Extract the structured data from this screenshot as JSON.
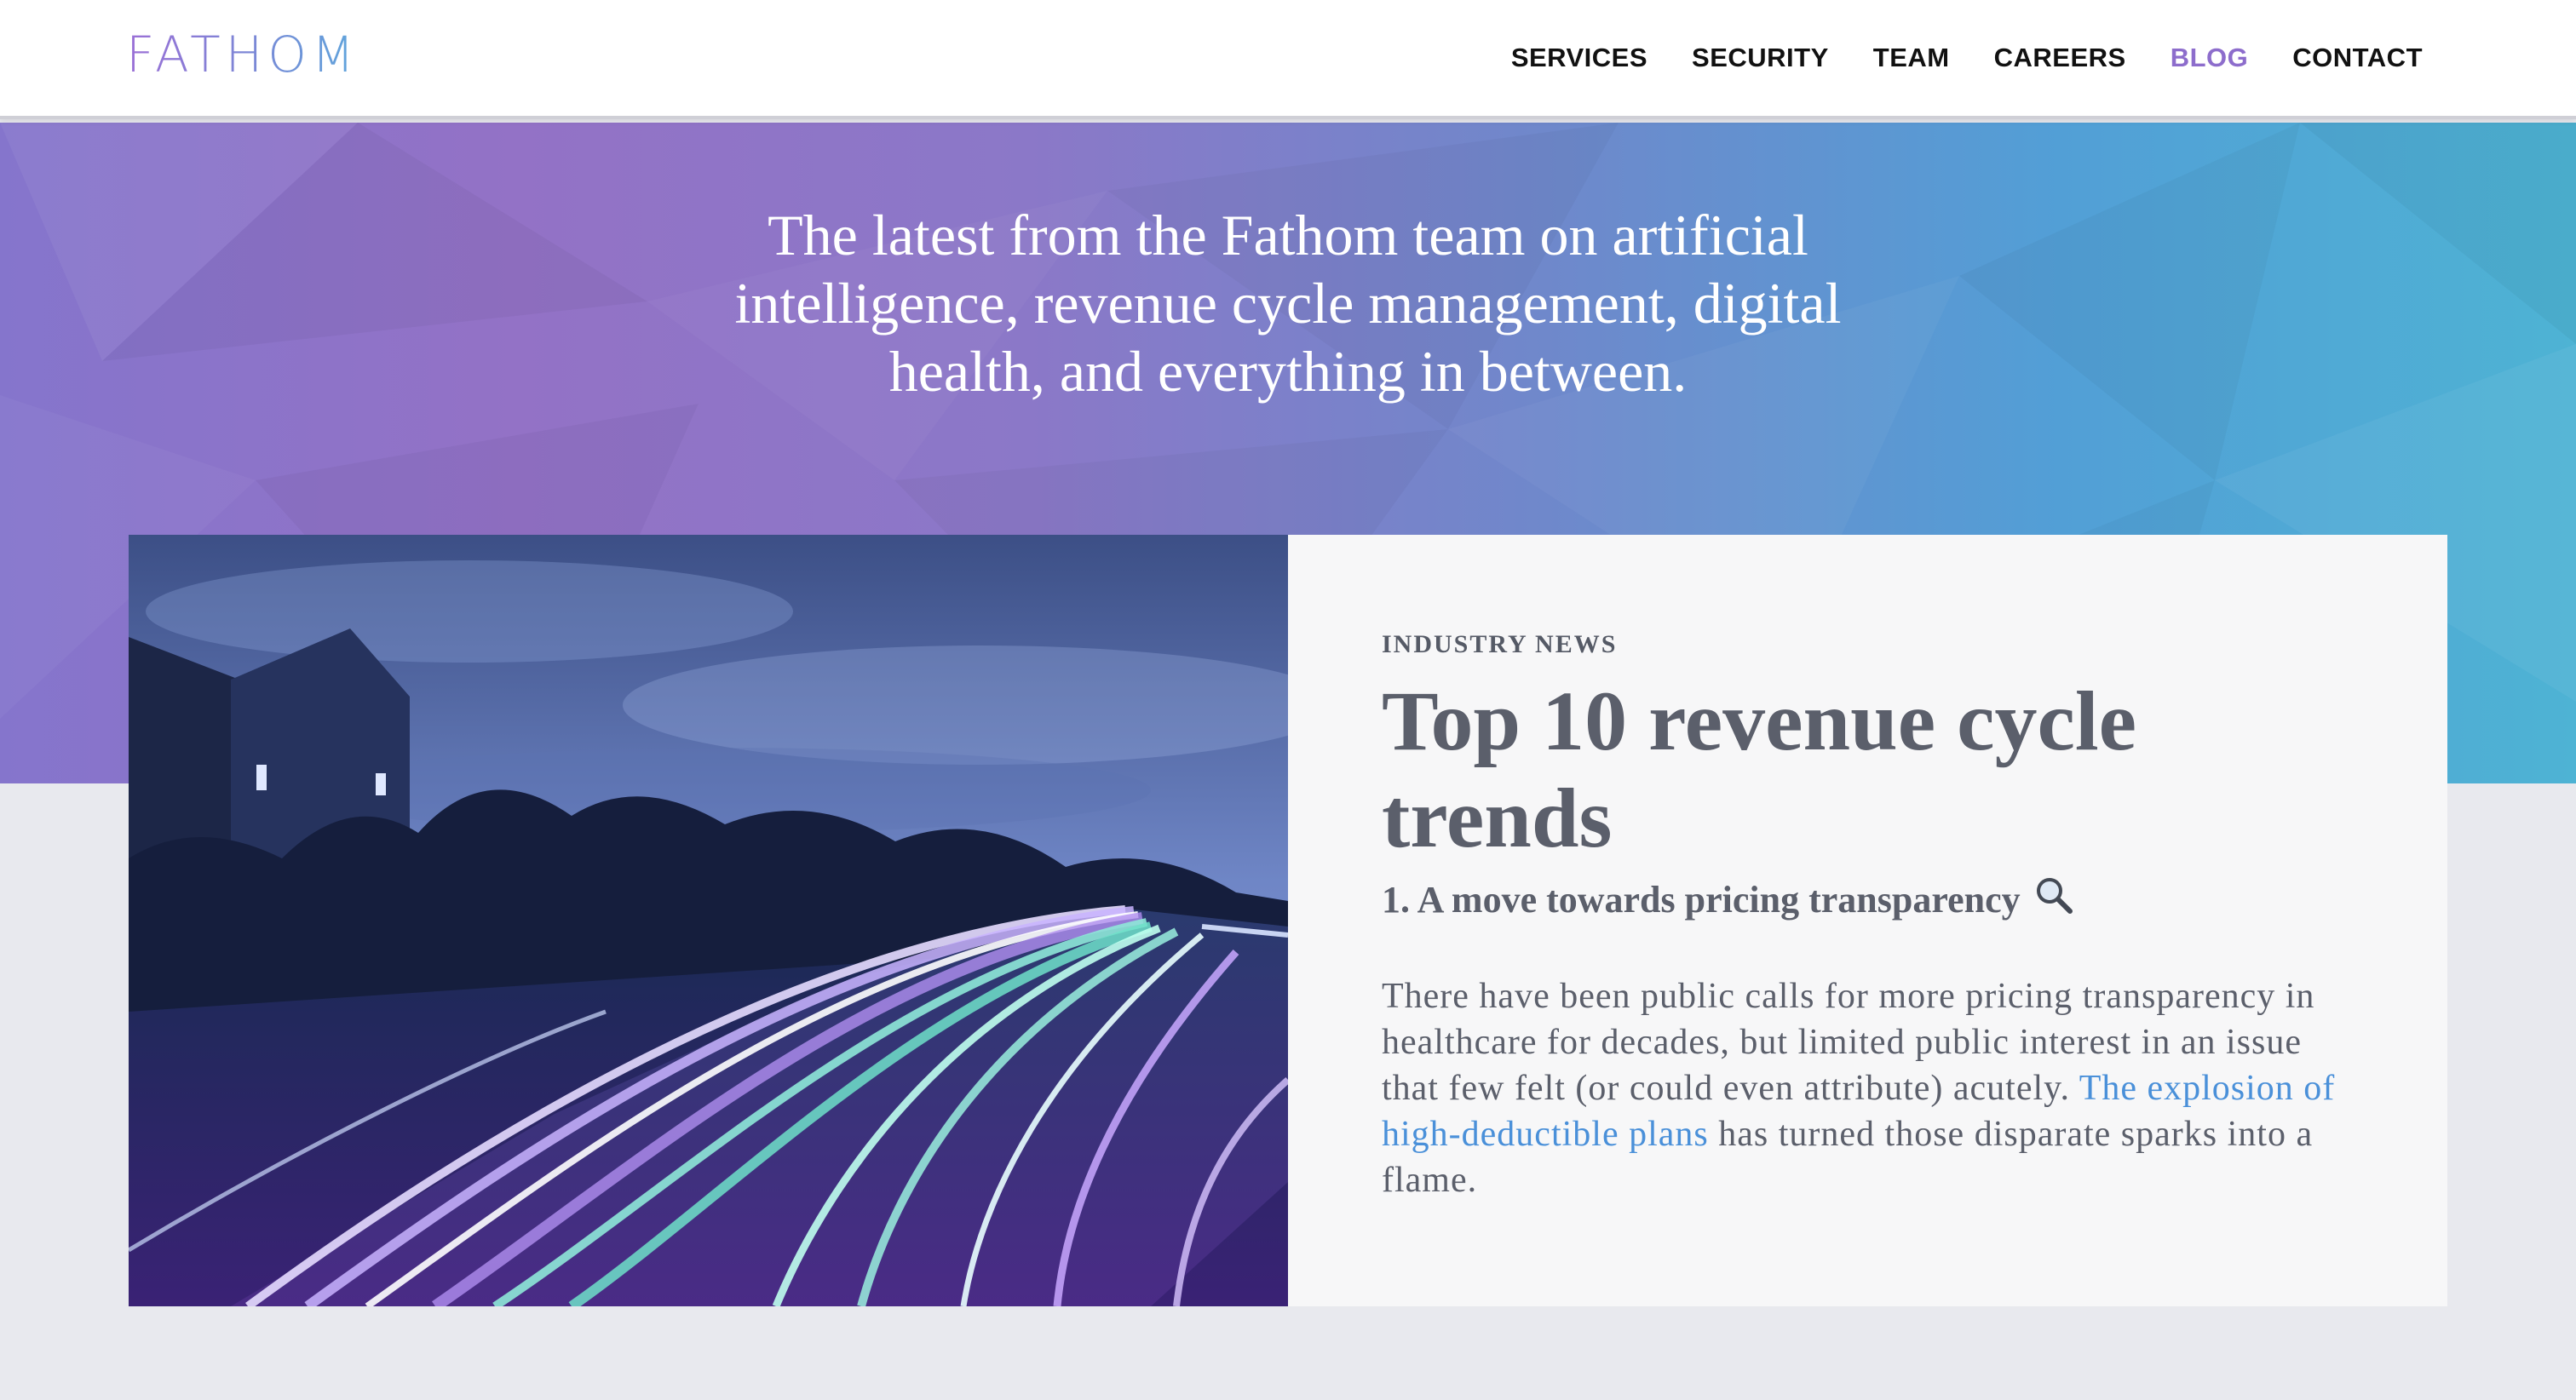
{
  "header": {
    "logo": "FATHOM",
    "nav": [
      {
        "label": "SERVICES",
        "active": false
      },
      {
        "label": "SECURITY",
        "active": false
      },
      {
        "label": "TEAM",
        "active": false
      },
      {
        "label": "CAREERS",
        "active": false
      },
      {
        "label": "BLOG",
        "active": true
      },
      {
        "label": "CONTACT",
        "active": false
      }
    ]
  },
  "hero": {
    "tagline": "The latest from the Fathom team on artificial intelligence, revenue cycle management, digital health, and everything in between."
  },
  "featured_post": {
    "category": "INDUSTRY NEWS",
    "title": "Top 10 revenue cycle trends",
    "subtitle": "1. A move towards pricing transparency",
    "subtitle_icon": "magnifying-glass-icon",
    "excerpt_before": "There have been public calls for more pricing transparency in healthcare for decades, but limited public interest in an issue that few felt (or could even attribute) acutely. ",
    "excerpt_link": "The explosion of high-deductible plans",
    "excerpt_after": " has turned those disparate sparks into a flame."
  },
  "colors": {
    "brand_purple": "#8d6dcc",
    "brand_blue": "#4eb3d4",
    "link_blue": "#4a90d9",
    "text_gray": "#5b5f6b"
  }
}
